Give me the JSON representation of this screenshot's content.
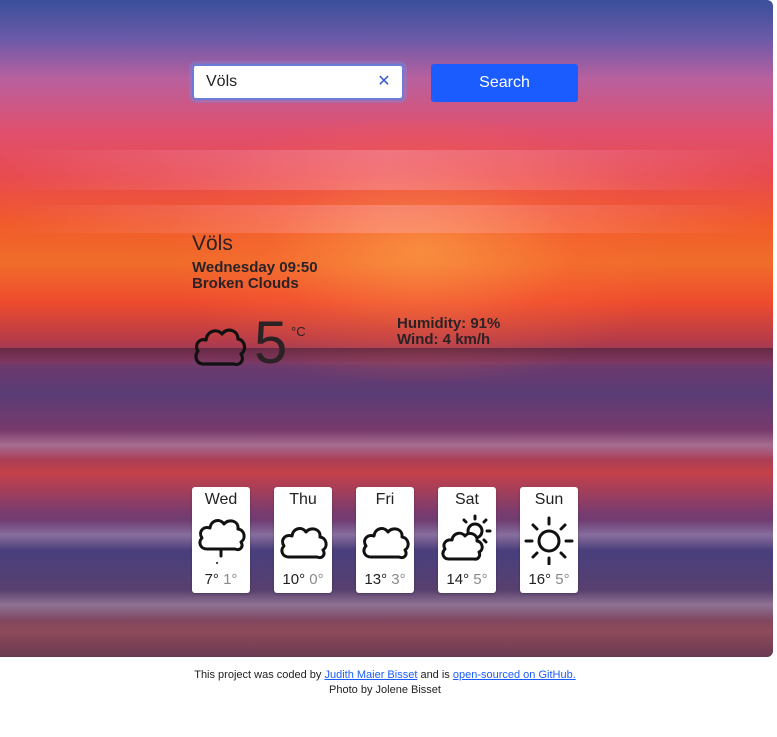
{
  "search": {
    "value": "Völs",
    "button_label": "Search"
  },
  "current": {
    "city": "Völs",
    "datetime": "Wednesday 09:50",
    "condition": "Broken Clouds",
    "icon": "cloud-icon",
    "temperature": "5",
    "unit": "°C",
    "humidity": "Humidity: 91%",
    "wind": "Wind: 4 km/h"
  },
  "forecast": [
    {
      "day": "Wed",
      "icon": "rain-cloud-icon",
      "high": "7°",
      "low": "1°"
    },
    {
      "day": "Thu",
      "icon": "cloud-icon",
      "high": "10°",
      "low": "0°"
    },
    {
      "day": "Fri",
      "icon": "cloud-icon",
      "high": "13°",
      "low": "3°"
    },
    {
      "day": "Sat",
      "icon": "partly-cloudy-icon",
      "high": "14°",
      "low": "5°"
    },
    {
      "day": "Sun",
      "icon": "sun-icon",
      "high": "16°",
      "low": "5°"
    }
  ],
  "footer": {
    "text_before": "This project was coded by ",
    "author_link": "Judith Maier Bisset",
    "text_middle": " and is ",
    "github_link": "open-sourced on GitHub.",
    "photo_credit": "Photo by Jolene Bisset"
  },
  "colors": {
    "accent": "#1a5cff",
    "text_dark": "#2b2226",
    "low_temp": "#8a8a8a"
  }
}
